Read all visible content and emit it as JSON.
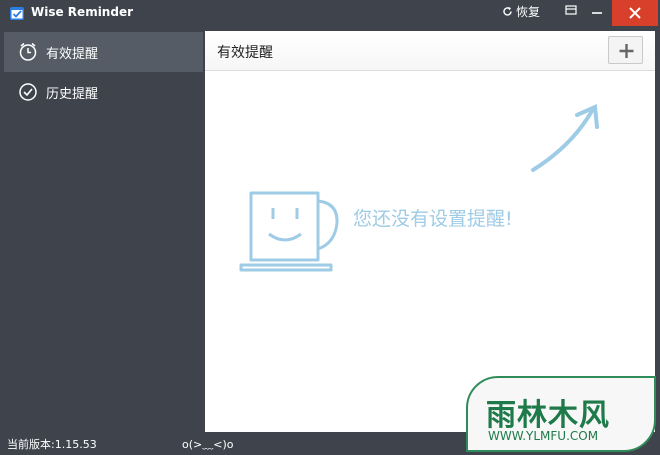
{
  "window": {
    "title": "Wise Reminder",
    "restore_label": "恢复",
    "icons": [
      "app-icon",
      "restore-icon",
      "menu-icon",
      "minimize-icon",
      "close-icon"
    ],
    "close_color": "#d8402b"
  },
  "sidebar": {
    "items": [
      {
        "label": "有效提醒",
        "icon": "clock-icon",
        "active": true
      },
      {
        "label": "历史提醒",
        "icon": "check-circle-icon",
        "active": false
      }
    ]
  },
  "main": {
    "title": "有效提醒",
    "add_icon": "plus-icon",
    "empty_text": "您还没有设置提醒!",
    "empty_icons": [
      "coffee-cup-icon",
      "arrow-icon"
    ],
    "accent_color": "#9ecbe6"
  },
  "status": {
    "version": "当前版本:1.15.53",
    "emoticon": "o(>﹏<)o"
  },
  "watermark": {
    "text": "雨林木风",
    "url": "WWW.YLMFU.COM"
  }
}
